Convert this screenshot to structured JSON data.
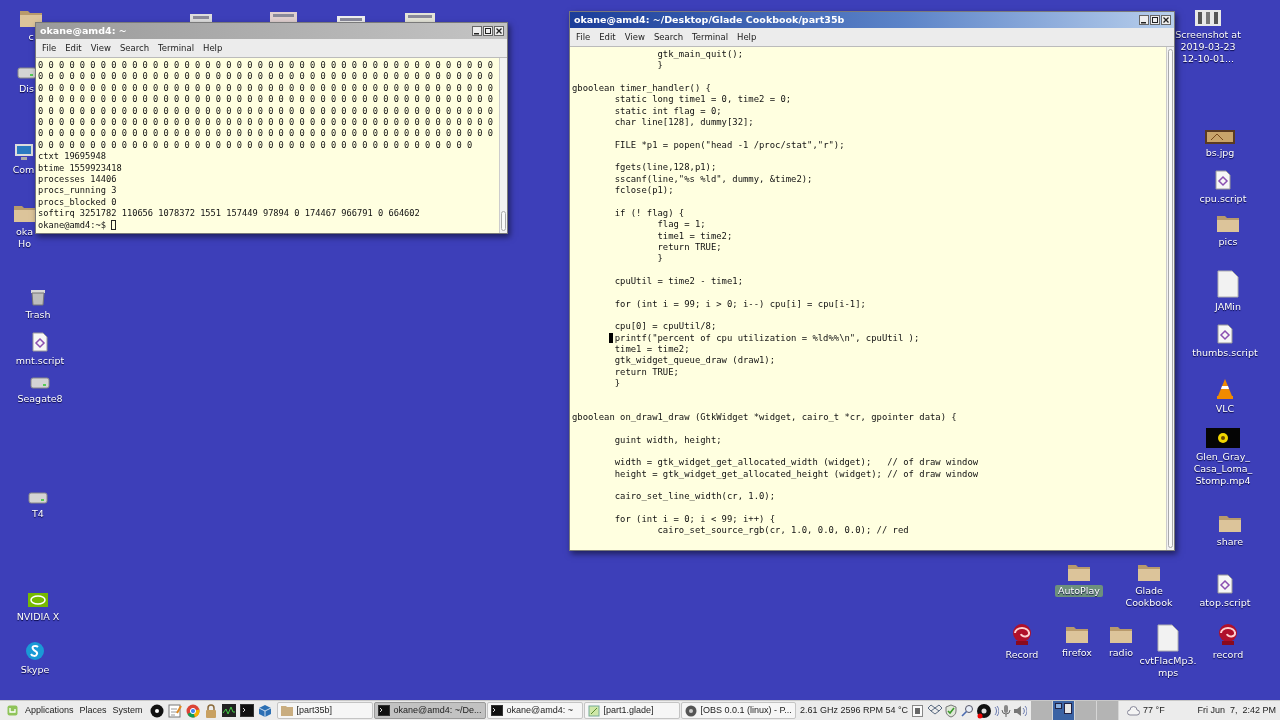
{
  "desktop_icons": [
    {
      "label": "c",
      "kind": "folder",
      "selected": false
    },
    {
      "label": "Dis",
      "kind": "drive",
      "selected": false
    },
    {
      "label": "Com",
      "kind": "monitor",
      "selected": false
    },
    {
      "label": "oka Ho",
      "kind": "folder",
      "selected": false
    },
    {
      "label": "Trash",
      "kind": "trash",
      "selected": false
    },
    {
      "label": "mnt.script",
      "kind": "script",
      "selected": false
    },
    {
      "label": "Seagate8",
      "kind": "drive",
      "selected": false
    },
    {
      "label": "T4",
      "kind": "drive",
      "selected": false
    },
    {
      "label": "NVIDIA X",
      "kind": "nvidia",
      "selected": false
    },
    {
      "label": "Skype",
      "kind": "skype",
      "selected": false
    },
    {
      "label": "Screenshot at 2019-03-23 12-10-01...",
      "kind": "screenshot",
      "selected": false
    },
    {
      "label": "bs.jpg",
      "kind": "image",
      "selected": false
    },
    {
      "label": "cpu.script",
      "kind": "script",
      "selected": false
    },
    {
      "label": "pics",
      "kind": "folder",
      "selected": false
    },
    {
      "label": "JAMin",
      "kind": "file",
      "selected": false
    },
    {
      "label": "thumbs.script",
      "kind": "script",
      "selected": false
    },
    {
      "label": "VLC",
      "kind": "vlc",
      "selected": false
    },
    {
      "label": "Glen_Gray_ Casa_Loma_ Stomp.mp4",
      "kind": "video",
      "selected": false
    },
    {
      "label": "share",
      "kind": "folder",
      "selected": false
    },
    {
      "label": "AutoPlay",
      "kind": "folder",
      "selected": true
    },
    {
      "label": "Glade Cookbook",
      "kind": "folder",
      "selected": false
    },
    {
      "label": "atop.script",
      "kind": "script",
      "selected": false
    },
    {
      "label": "Record",
      "kind": "record",
      "selected": false
    },
    {
      "label": "firefox",
      "kind": "folder",
      "selected": false
    },
    {
      "label": "radio",
      "kind": "folder",
      "selected": false
    },
    {
      "label": "cvtFlacMp3. mps",
      "kind": "file",
      "selected": false
    },
    {
      "label": "record",
      "kind": "record",
      "selected": false
    }
  ],
  "windows": [
    {
      "kind": "terminal",
      "title": "okane@amd4: ~",
      "active": false,
      "menu": [
        "File",
        "Edit",
        "View",
        "Search",
        "Terminal",
        "Help"
      ],
      "lines": [
        "0 0 0 0 0 0 0 0 0 0 0 0 0 0 0 0 0 0 0 0 0 0 0 0 0 0 0 0 0 0 0 0 0 0 0 0 0 0 0 0 0 0 0 0",
        "0 0 0 0 0 0 0 0 0 0 0 0 0 0 0 0 0 0 0 0 0 0 0 0 0 0 0 0 0 0 0 0 0 0 0 0 0 0 0 0 0 0 0 0",
        "0 0 0 0 0 0 0 0 0 0 0 0 0 0 0 0 0 0 0 0 0 0 0 0 0 0 0 0 0 0 0 0 0 0 0 0 0 0 0 0 0 0 0 0",
        "0 0 0 0 0 0 0 0 0 0 0 0 0 0 0 0 0 0 0 0 0 0 0 0 0 0 0 0 0 0 0 0 0 0 0 0 0 0 0 0 0 0 0 0",
        "0 0 0 0 0 0 0 0 0 0 0 0 0 0 0 0 0 0 0 0 0 0 0 0 0 0 0 0 0 0 0 0 0 0 0 0 0 0 0 0 0 0 0 0",
        "0 0 0 0 0 0 0 0 0 0 0 0 0 0 0 0 0 0 0 0 0 0 0 0 0 0 0 0 0 0 0 0 0 0 0 0 0 0 0 0 0 0 0 0",
        "0 0 0 0 0 0 0 0 0 0 0 0 0 0 0 0 0 0 0 0 0 0 0 0 0 0 0 0 0 0 0 0 0 0 0 0 0 0 0 0 0 0 0 0",
        "0 0 0 0 0 0 0 0 0 0 0 0 0 0 0 0 0 0 0 0 0 0 0 0 0 0 0 0 0 0 0 0 0 0 0 0 0 0 0 0 0 0",
        "ctxt 19695948",
        "btime 1559923418",
        "processes 14406",
        "procs_running 3",
        "procs_blocked 0",
        "softirq 3251782 110656 1078372 1551 157449 97894 0 174467 966791 0 664602"
      ],
      "prompt": "okane@amd4:~$"
    },
    {
      "kind": "editor",
      "title": "okane@amd4: ~/Desktop/Glade Cookbook/part35b",
      "active": true,
      "menu": [
        "File",
        "Edit",
        "View",
        "Search",
        "Terminal",
        "Help"
      ],
      "lines": [
        {
          "kind": "code",
          "text": "                gtk_main_quit();"
        },
        {
          "kind": "code",
          "text": "                }"
        },
        {
          "kind": "blank"
        },
        {
          "kind": "code",
          "text": "gboolean timer_handler() {"
        },
        {
          "kind": "code",
          "text": "        static long time1 = 0, time2 = 0;"
        },
        {
          "kind": "code",
          "text": "        static int flag = 0;"
        },
        {
          "kind": "code",
          "text": "        char line[128], dummy[32];"
        },
        {
          "kind": "blank"
        },
        {
          "kind": "code",
          "text": "        FILE *p1 = popen(\"head -1 /proc/stat\",\"r\");"
        },
        {
          "kind": "blank"
        },
        {
          "kind": "code",
          "text": "        fgets(line,128,p1);"
        },
        {
          "kind": "code",
          "text": "        sscanf(line,\"%s %ld\", dummy, &time2);"
        },
        {
          "kind": "code",
          "text": "        fclose(p1);"
        },
        {
          "kind": "blank"
        },
        {
          "kind": "code",
          "text": "        if (! flag) {"
        },
        {
          "kind": "code",
          "text": "                flag = 1;"
        },
        {
          "kind": "code",
          "text": "                time1 = time2;"
        },
        {
          "kind": "code",
          "text": "                return TRUE;"
        },
        {
          "kind": "code",
          "text": "                }"
        },
        {
          "kind": "blank"
        },
        {
          "kind": "code",
          "text": "        cpuUtil = time2 - time1;"
        },
        {
          "kind": "blank"
        },
        {
          "kind": "code",
          "text": "        for (int i = 99; i > 0; i--) cpu[i] = cpu[i-1];"
        },
        {
          "kind": "blank"
        },
        {
          "kind": "code",
          "text": "        cpu[0] = cpuUtil/8;"
        },
        {
          "kind": "cursor",
          "text": "        printf(\"percent of cpu utilization = %ld%%\\n\", cpuUtil );"
        },
        {
          "kind": "code",
          "text": "        time1 = time2;"
        },
        {
          "kind": "code",
          "text": "        gtk_widget_queue_draw (draw1);"
        },
        {
          "kind": "code",
          "text": "        return TRUE;"
        },
        {
          "kind": "code",
          "text": "        }"
        },
        {
          "kind": "blank"
        },
        {
          "kind": "blank"
        },
        {
          "kind": "code",
          "text": "gboolean on_draw1_draw (GtkWidget *widget, cairo_t *cr, gpointer data) {"
        },
        {
          "kind": "blank"
        },
        {
          "kind": "code",
          "text": "        guint width, height;"
        },
        {
          "kind": "blank"
        },
        {
          "kind": "code",
          "text": "        width = gtk_widget_get_allocated_width (widget);   // of draw window"
        },
        {
          "kind": "code",
          "text": "        height = gtk_widget_get_allocated_height (widget); // of draw window"
        },
        {
          "kind": "blank"
        },
        {
          "kind": "code",
          "text": "        cairo_set_line_width(cr, 1.0);"
        },
        {
          "kind": "blank"
        },
        {
          "kind": "code",
          "text": "        for (int i = 0; i < 99; i++) {"
        },
        {
          "kind": "code",
          "text": "                cairo_set_source_rgb(cr, 1.0, 0.0, 0.0); // red"
        }
      ]
    }
  ],
  "taskbar": {
    "menus": [
      "Applications",
      "Places",
      "System"
    ],
    "tasks": [
      {
        "label": "[part35b]",
        "kind": "folder",
        "selected": false
      },
      {
        "label": "okane@amd4: ~/De...",
        "kind": "terminal",
        "selected": true
      },
      {
        "label": "okane@amd4: ~",
        "kind": "terminal",
        "selected": false
      },
      {
        "label": "[part1.glade]",
        "kind": "glade",
        "selected": false
      },
      {
        "label": "[OBS 0.0.1 (linux) - P...",
        "kind": "obs",
        "selected": false
      }
    ],
    "sensors": "2.61 GHz 2596 RPM 54 °C",
    "workspaces": [
      {
        "selected": false
      },
      {
        "selected": true
      },
      {
        "selected": false
      },
      {
        "selected": false
      }
    ],
    "weather": "77 °F",
    "clock": "Fri Jun  7,  2:42 PM"
  }
}
